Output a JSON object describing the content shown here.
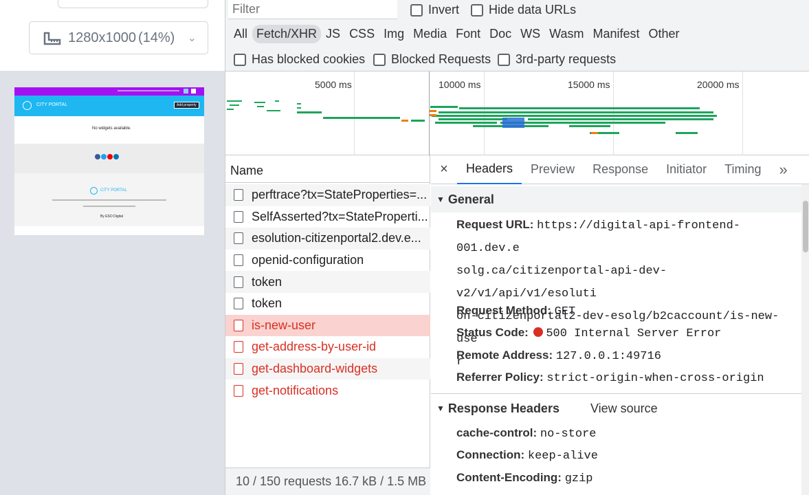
{
  "device": {
    "size": "1280x1000",
    "zoom": "(14%)"
  },
  "preview": {
    "brand": "CITY PORTAL",
    "button": "Add property",
    "empty": "No widgets available.",
    "footer_brand": "CITY PORTAL",
    "footer_links": [
      "Terms of Use",
      "Accessibility",
      "Privacy Policy"
    ],
    "powered": "By ESO Digital",
    "colors": {
      "purple": "#a311f2",
      "blue": "#1eb7f2"
    }
  },
  "toolbar": {
    "filter_placeholder": "Filter",
    "invert": "Invert",
    "hide_data_urls": "Hide data URLs",
    "type_filters": [
      "All",
      "Fetch/XHR",
      "JS",
      "CSS",
      "Img",
      "Media",
      "Font",
      "Doc",
      "WS",
      "Wasm",
      "Manifest",
      "Other"
    ],
    "selected_filter": "Fetch/XHR",
    "has_blocked_cookies": "Has blocked cookies",
    "blocked_requests": "Blocked Requests",
    "third_party": "3rd-party requests"
  },
  "timeline": {
    "ticks": [
      "5000 ms",
      "10000 ms",
      "15000 ms",
      "20000 ms"
    ]
  },
  "requests": {
    "header": "Name",
    "items": [
      {
        "name": "perftrace?tx=StateProperties=...",
        "error": false
      },
      {
        "name": "SelfAsserted?tx=StateProperti...",
        "error": false
      },
      {
        "name": "esolution-citizenportal2.dev.e...",
        "error": false
      },
      {
        "name": "openid-configuration",
        "error": false
      },
      {
        "name": "token",
        "error": false
      },
      {
        "name": "token",
        "error": false
      },
      {
        "name": "is-new-user",
        "error": true
      },
      {
        "name": "get-address-by-user-id",
        "error": true
      },
      {
        "name": "get-dashboard-widgets",
        "error": true
      },
      {
        "name": "get-notifications",
        "error": true
      }
    ],
    "status": "10 / 150 requests    16.7 kB / 1.5 MB"
  },
  "details": {
    "tabs": [
      "Headers",
      "Preview",
      "Response",
      "Initiator",
      "Timing"
    ],
    "more": "»",
    "close": "×",
    "general": {
      "title": "General",
      "request_url_label": "Request URL:",
      "request_url_lines": [
        "https://digital-api-frontend-001.dev.e",
        "solg.ca/citizenportal-api-dev-v2/v1/api/v1/esoluti",
        "on-citizenportal2-dev-esolg/b2caccount/is-new-use",
        "r"
      ],
      "request_method_label": "Request Method:",
      "request_method": "GET",
      "status_code_label": "Status Code:",
      "status_code": "500 Internal Server Error",
      "remote_address_label": "Remote Address:",
      "remote_address": "127.0.0.1:49716",
      "referrer_policy_label": "Referrer Policy:",
      "referrer_policy": "strict-origin-when-cross-origin"
    },
    "response_headers": {
      "title": "Response Headers",
      "view_source": "View source",
      "items": [
        {
          "label": "cache-control:",
          "value": "no-store"
        },
        {
          "label": "Connection:",
          "value": "keep-alive"
        },
        {
          "label": "Content-Encoding:",
          "value": "gzip"
        }
      ]
    },
    "colors": {
      "error": "#d93025",
      "accent": "#1a73e8"
    }
  }
}
